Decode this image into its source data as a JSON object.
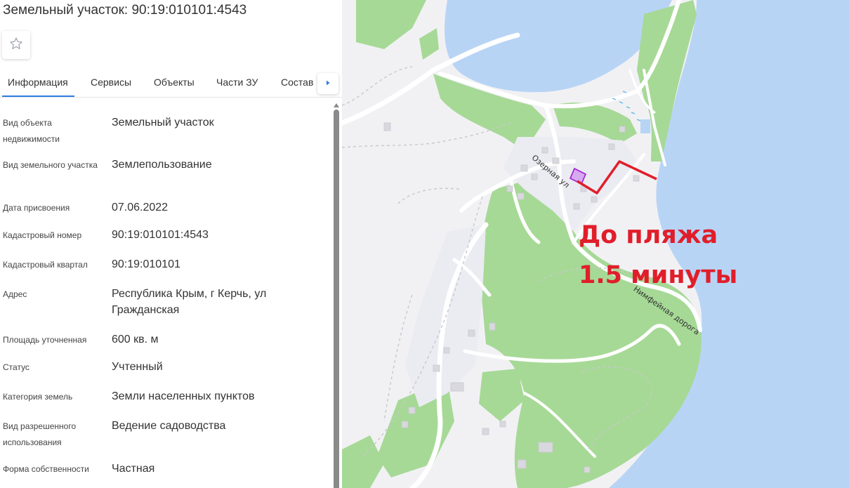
{
  "title": "Земельный участок: 90:19:010101:4543",
  "tabs": [
    {
      "label": "Информация",
      "active": true
    },
    {
      "label": "Сервисы"
    },
    {
      "label": "Объекты"
    },
    {
      "label": "Части ЗУ"
    },
    {
      "label": "Состав"
    }
  ],
  "properties": [
    {
      "label": "Вид объекта недвижимости",
      "value": "Земельный участок"
    },
    {
      "label": "Вид земельного участка",
      "value": "Землепользование"
    },
    {
      "label": "Дата присвоения",
      "value": "07.06.2022"
    },
    {
      "label": "Кадастровый номер",
      "value": "90:19:010101:4543"
    },
    {
      "label": "Кадастровый квартал",
      "value": "90:19:010101"
    },
    {
      "label": "Адрес",
      "value": "Республика Крым, г Керчь, ул Гражданская"
    },
    {
      "label": "Площадь уточненная",
      "value": "600 кв. м"
    },
    {
      "label": "Статус",
      "value": "Учтенный"
    },
    {
      "label": "Категория земель",
      "value": "Земли населенных пунктов"
    },
    {
      "label": "Вид разрешенного использования",
      "value": "Ведение садоводства"
    },
    {
      "label": "Форма собственности",
      "value": "Частная"
    }
  ],
  "map": {
    "annotation_line1": "До пляжа",
    "annotation_line2": "1.5 минуты",
    "street_ozernaya": "Озерная ул",
    "street_nimfeynaya": "Нимфейная дорога"
  },
  "colors": {
    "accent": "#2f7de1",
    "water": "#b8d4f5",
    "green": "#a6d996",
    "annotation": "#e01e2a",
    "parcel": "#a020d0"
  },
  "icons": {
    "favorite": "star-outline-icon",
    "tab_next": "caret-right-icon"
  }
}
